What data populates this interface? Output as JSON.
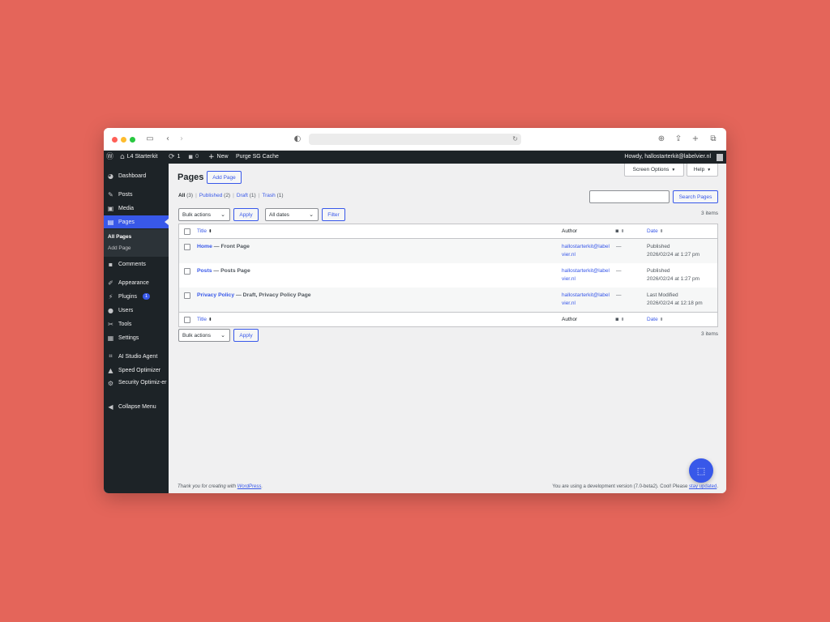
{
  "browser": {
    "icons": [
      "sidebar-toggle-icon",
      "back-icon",
      "forward-icon",
      "privacy-shield-icon",
      "reload-icon",
      "download-icon",
      "share-icon",
      "new-tab-icon",
      "tab-overview-icon"
    ]
  },
  "adminbar": {
    "site_name": "L4 Starterkit",
    "updates_count": "1",
    "comments_count": "0",
    "new_label": "New",
    "purge_label": "Purge SG Cache",
    "howdy": "Howdy, hallostarterkit@labelvier.nl"
  },
  "sidebar": {
    "items": [
      {
        "label": "Dashboard",
        "icon": "dashboard-icon"
      },
      {
        "label": "Posts",
        "icon": "pin-icon"
      },
      {
        "label": "Media",
        "icon": "media-icon"
      },
      {
        "label": "Pages",
        "icon": "pages-icon"
      },
      {
        "label": "Comments",
        "icon": "comment-icon"
      },
      {
        "label": "Appearance",
        "icon": "brush-icon"
      },
      {
        "label": "Plugins",
        "icon": "plugin-icon",
        "badge": "1"
      },
      {
        "label": "Users",
        "icon": "user-icon"
      },
      {
        "label": "Tools",
        "icon": "wrench-icon"
      },
      {
        "label": "Settings",
        "icon": "settings-icon"
      },
      {
        "label": "AI Studio Agent",
        "icon": "ai-studio-icon"
      },
      {
        "label": "Speed Optimizer",
        "icon": "speed-icon"
      },
      {
        "label": "Security Optimiz-er",
        "icon": "security-icon"
      },
      {
        "label": "Collapse Menu",
        "icon": "collapse-icon"
      }
    ],
    "submenu": [
      "All Pages",
      "Add Page"
    ]
  },
  "screen_options": "Screen Options",
  "help": "Help",
  "page_title": "Pages",
  "add_page": "Add Page",
  "filters": {
    "all": "All",
    "all_count": "(3)",
    "published": "Published",
    "published_count": "(2)",
    "draft": "Draft",
    "draft_count": "(1)",
    "trash": "Trash",
    "trash_count": "(1)"
  },
  "search_button": "Search Pages",
  "bulk_actions": "Bulk actions",
  "apply": "Apply",
  "all_dates": "All dates",
  "filter": "Filter",
  "items_count": "3 items",
  "table": {
    "col_title": "Title",
    "col_author": "Author",
    "col_date": "Date",
    "rows": [
      {
        "title": "Home",
        "state": " — Front Page",
        "author": "hallostarterkit@labelvier.nl",
        "comments": "—",
        "status": "Published",
        "date": "2026/02/24 at 1:27 pm"
      },
      {
        "title": "Posts",
        "state": " — Posts Page",
        "author": "hallostarterkit@labelvier.nl",
        "comments": "—",
        "status": "Published",
        "date": "2026/02/24 at 1:27 pm"
      },
      {
        "title": "Privacy Policy",
        "state": " — Draft, Privacy Policy Page",
        "author": "hallostarterkit@labelvier.nl",
        "comments": "—",
        "status": "Last Modified",
        "date": "2026/02/24 at 12:18 pm"
      }
    ]
  },
  "footer": {
    "thanks": "Thank you for creating with ",
    "wordpress": "WordPress",
    "thanks_end": ".",
    "version": "You are using a development version (7.0-beta2). Cool! Please ",
    "stay_updated": "stay updated",
    "version_end": "."
  }
}
